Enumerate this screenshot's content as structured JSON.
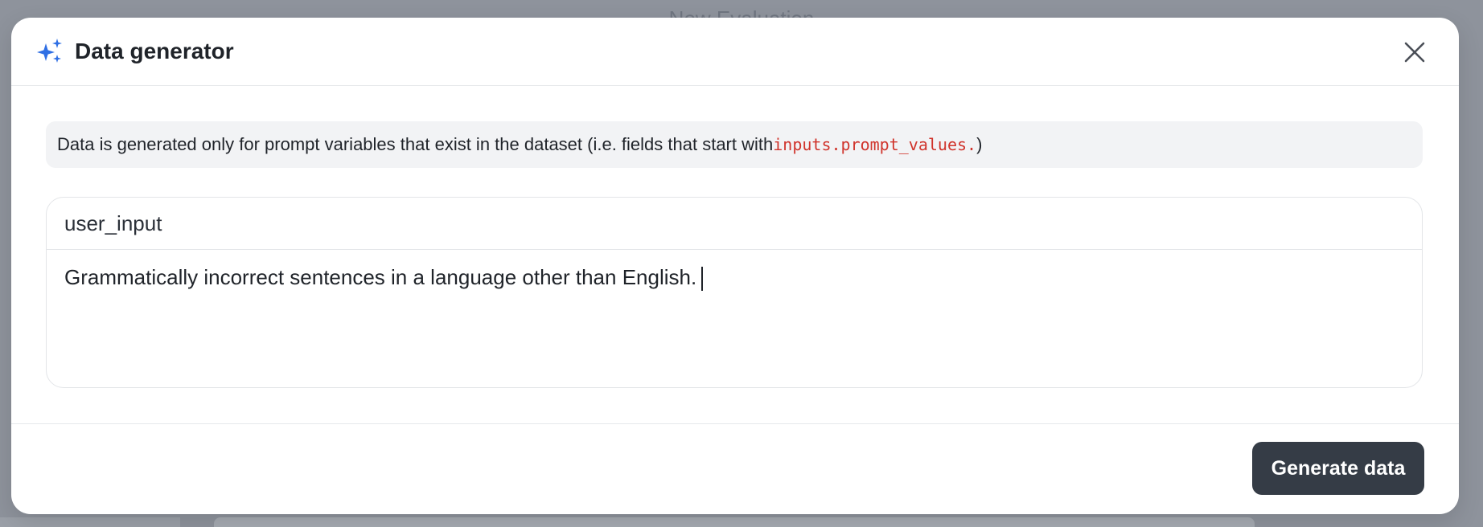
{
  "background": {
    "page_title": "New Evaluation"
  },
  "modal": {
    "title": "Data generator",
    "icon": "sparkles-icon",
    "close_icon": "close-icon",
    "info": {
      "text_before": "Data is generated only for prompt variables that exist in the dataset (i.e. fields that start with ",
      "code": "inputs.prompt_values.",
      "text_after": ")"
    },
    "field": {
      "label": "user_input",
      "value": "Grammatically incorrect sentences in a language other than English."
    },
    "footer": {
      "generate_label": "Generate data"
    }
  },
  "colors": {
    "accent_icon": "#2f6fe4",
    "button_bg": "#353c46",
    "code_text": "#d0342c",
    "banner_bg": "#f2f3f5"
  }
}
